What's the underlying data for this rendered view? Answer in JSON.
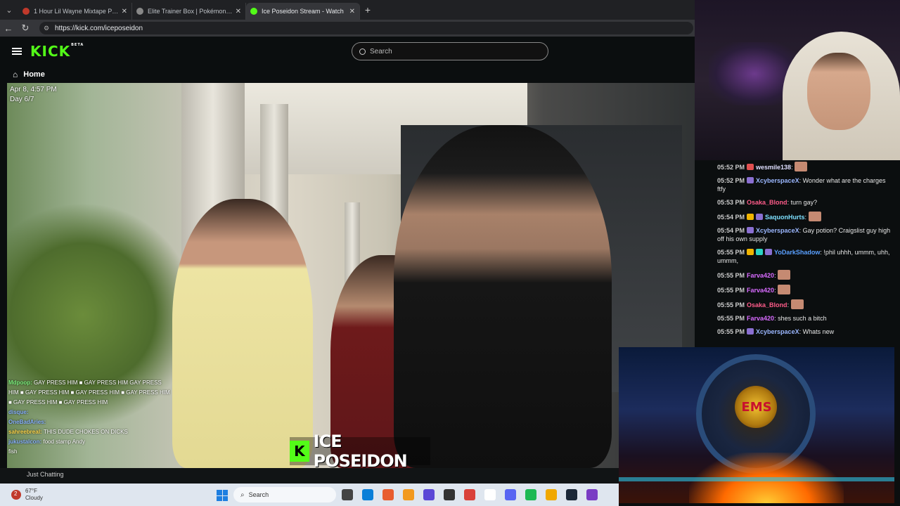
{
  "browser": {
    "tabs": [
      {
        "title": "1 Hour Lil Wayne Mixtape Prime",
        "fav_color": "#c0392b",
        "active": false
      },
      {
        "title": "Elite Trainer Box | Pokémon Center",
        "fav_color": "#888888",
        "active": false
      },
      {
        "title": "Ice Poseidon Stream - Watch",
        "fav_color": "#53fc18",
        "active": true
      }
    ],
    "url": "https://kick.com/iceposeidon"
  },
  "kick": {
    "logo": "KICK",
    "beta": "BETA",
    "search_placeholder": "Search",
    "home_label": "Home",
    "category": "Just Chatting"
  },
  "video": {
    "date": "Apr 8, 4:57 PM",
    "day": "Day 6/7",
    "nameplate_k": "K",
    "nameplate_text": "ICE POSEIDON",
    "overlay_chat": [
      {
        "user": "Mdpoop",
        "text": "GAY PRESS HIM ■ GAY PRESS HIM GAY PRESS HIM ■ GAY PRESS HIM ■ GAY PRESS HIM ■ GAY PRESS HIM ■ GAY PRESS HIM ■ GAY PRESS HIM",
        "cls": "u"
      },
      {
        "user": "disque",
        "text": "",
        "cls": "u3"
      },
      {
        "user": "OneBadAries",
        "text": "",
        "cls": "u3"
      },
      {
        "user": "sahreebreal",
        "text": "THIS DUDE CHOKES ON DICKS",
        "cls": "u2"
      },
      {
        "user": "jukustalcon",
        "text": "food stamp Andy",
        "cls": "u3"
      },
      {
        "user": "",
        "text": "fish",
        "cls": "u"
      }
    ]
  },
  "chat": [
    {
      "time": "05:52 PM",
      "user": "wesmile138",
      "color": "#e0e0ff",
      "text": "",
      "emote": true,
      "badges": [
        "#e05050"
      ]
    },
    {
      "time": "05:52 PM",
      "user": "XcyberspaceX",
      "color": "#9bb7ff",
      "text": "Wonder what are the charges ftfy",
      "emote": false,
      "badges": [
        "#8a6fd1"
      ]
    },
    {
      "time": "05:53 PM",
      "user": "Osaka_Blond",
      "color": "#ff5c8a",
      "text": "turn gay?",
      "emote": false,
      "badges": []
    },
    {
      "time": "05:54 PM",
      "user": "SaquonHurts",
      "color": "#7ee0ff",
      "text": "",
      "emote": true,
      "badges": [
        "#f0b400",
        "#8a6fd1"
      ]
    },
    {
      "time": "05:54 PM",
      "user": "XcyberspaceX",
      "color": "#9bb7ff",
      "text": "Gay potion? Craigslist guy high off his own supply",
      "emote": false,
      "badges": [
        "#8a6fd1"
      ]
    },
    {
      "time": "05:55 PM",
      "user": "YoDarkShadow",
      "color": "#5aa0ff",
      "text": "!phil uhhh, ummm, uhh, ummm,",
      "emote": false,
      "badges": [
        "#f0b400",
        "#2bd4c4",
        "#8a6fd1"
      ]
    },
    {
      "time": "05:55 PM",
      "user": "Farva420",
      "color": "#d86bff",
      "text": "",
      "emote": true,
      "badges": []
    },
    {
      "time": "05:55 PM",
      "user": "Farva420",
      "color": "#d86bff",
      "text": "",
      "emote": true,
      "badges": []
    },
    {
      "time": "05:55 PM",
      "user": "Osaka_Blond",
      "color": "#ff5c8a",
      "text": "",
      "emote": true,
      "badges": []
    },
    {
      "time": "05:55 PM",
      "user": "Farva420",
      "color": "#d86bff",
      "text": "shes such a bitch",
      "emote": false,
      "badges": []
    },
    {
      "time": "05:55 PM",
      "user": "XcyberspaceX",
      "color": "#9bb7ff",
      "text": "Whats new",
      "emote": false,
      "badges": [
        "#8a6fd1"
      ]
    }
  ],
  "pokemon": {
    "emblem_text": "EMS"
  },
  "taskbar": {
    "temp": "67°F",
    "condition": "Cloudy",
    "notif": "2",
    "search_label": "Search",
    "app_icons": [
      "#444444",
      "#0a7fd8",
      "#e85d2f",
      "#f29a1f",
      "#5b48d6",
      "#333333",
      "#d9413a",
      "#ffffff",
      "#5865f2",
      "#1db954",
      "#f0a800",
      "#1b2838",
      "#7a3cc4"
    ]
  }
}
